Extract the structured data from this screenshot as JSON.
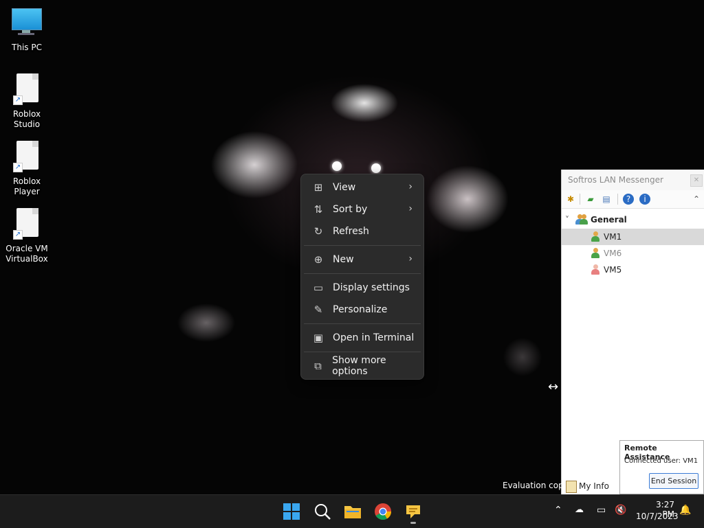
{
  "desktop": {
    "icons": [
      {
        "label": "This PC"
      },
      {
        "label": "Roblox Studio"
      },
      {
        "label": "Roblox Player"
      },
      {
        "label": "Oracle VM VirtualBox"
      }
    ],
    "evaluation_text": "Evaluation copy"
  },
  "context_menu": {
    "items": {
      "view": "View",
      "sort_by": "Sort by",
      "refresh": "Refresh",
      "new": "New",
      "display_settings": "Display settings",
      "personalize": "Personalize",
      "open_terminal": "Open in Terminal",
      "show_more": "Show more options"
    },
    "icons": {
      "view": "grid-icon",
      "sort_by": "sort-icon",
      "refresh": "refresh-icon",
      "new": "plus-circle-icon",
      "display_settings": "display-icon",
      "personalize": "pen-icon",
      "open_terminal": "terminal-icon",
      "show_more": "expand-icon"
    }
  },
  "messenger": {
    "title": "Softros LAN Messenger",
    "group": "General",
    "users": [
      {
        "name": "VM1",
        "status": "online",
        "selected": true
      },
      {
        "name": "VM6",
        "status": "away",
        "selected": false
      },
      {
        "name": "VM5",
        "status": "offline",
        "selected": false
      }
    ],
    "my_info": "My Info"
  },
  "remote_assistance": {
    "title": "Remote Assistance",
    "connected_label": "Connected user:",
    "connected_user": "VM1",
    "end_button": "End Session"
  },
  "taskbar": {
    "time": "3:27 PM",
    "date": "10/7/2023",
    "apps": [
      "start-icon",
      "search-icon",
      "file-explorer-icon",
      "chrome-icon",
      "messenger-icon"
    ]
  },
  "colors": {
    "menu_bg": "#2b2b2b",
    "taskbar_bg": "#1c1c1c",
    "accent": "#3a7bd5",
    "selected_row": "#d9d9d9"
  }
}
